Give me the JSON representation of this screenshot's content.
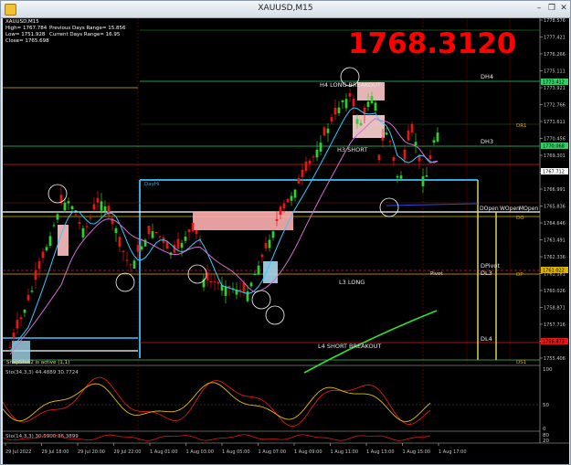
{
  "window": {
    "title": "XAUUSD,M15",
    "minimize_icon": "–",
    "restore_icon": "❐",
    "close_icon": "✕"
  },
  "info": {
    "symbol": "XAUUSD,M15",
    "high": "High= 1767.784",
    "low": "Low= 1751.928",
    "close": "Close= 1765.698",
    "prev_range": "Previous Days Range= 15.856",
    "curr_range": "Current Days Range= 16.95"
  },
  "big_price": "1768.3120",
  "price_scale": [
    "1778.576",
    "1777.421",
    "1776.266",
    "1775.111",
    "1773.921",
    "1772.766",
    "1771.611",
    "1770.456",
    "1769.301",
    "1768.146",
    "1766.991",
    "1765.836",
    "1764.646",
    "1763.491",
    "1762.336",
    "1761.181",
    "1760.026",
    "1758.871",
    "1757.716",
    "1756.561",
    "1755.406"
  ],
  "tags": {
    "dh4": "1773.412",
    "dh3": "1770.068",
    "current": "1767.712",
    "dl3": "1761.022",
    "dl4": "1756.873"
  },
  "labels": {
    "h4": "H4 LONG BREAKOUT",
    "h3": "H3 SHORT",
    "l3": "L3 LONG",
    "l4": "L4 SHORT BREAKOUT",
    "dh4": "DH4",
    "dh3": "DH3",
    "dr1": "DR1",
    "dopen": "DOpen",
    "wopen": "WOpen",
    "mopen": "MOpen",
    "do": "DO",
    "dpivot": "DPivot",
    "dl3": "DL3",
    "dp": "DP",
    "pivot": "Pivot",
    "dl4": "DL4",
    "ds1": "DS1",
    "dayhi": "DayHi",
    "snap": "SnapShot2 is active (1,1)"
  },
  "stoch1": {
    "title": "Sto(34,3,3) 44.4889 30.7724",
    "levels": [
      "100",
      "50",
      "0"
    ]
  },
  "stoch2": {
    "title": "Sto(14,3,3) 30.5900 36.3899",
    "levels": [
      "80",
      "20"
    ]
  },
  "time_axis": [
    "29 Jul 2022",
    "29 Jul 18:00",
    "29 Jul 20:00",
    "29 Jul 22:00",
    "1 Aug 01:00",
    "1 Aug 03:00",
    "1 Aug 05:00",
    "1 Aug 07:00",
    "1 Aug 09:00",
    "1 Aug 11:00",
    "1 Aug 13:00",
    "1 Aug 15:00",
    "1 Aug 17:00"
  ],
  "colors": {
    "bull": "#33cc33",
    "bear": "#e01818",
    "accent": "#ff0000"
  }
}
